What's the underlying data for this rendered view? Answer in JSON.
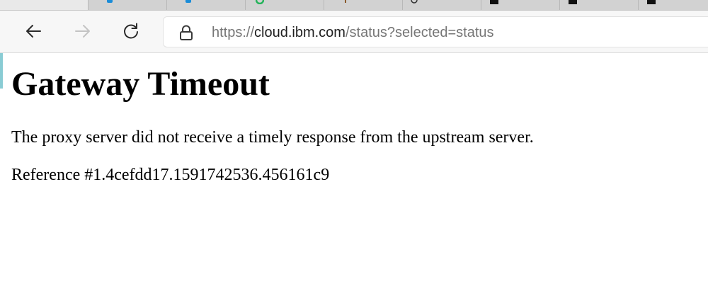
{
  "browser": {
    "tabs": [
      {
        "icon": "blue-favicon-icon",
        "accent": "#1a8cd8",
        "active": true
      },
      {
        "icon": "blue-favicon-icon",
        "accent": "#1a8cd8",
        "active": false
      },
      {
        "icon": "green-favicon-icon",
        "accent": "#24b35a",
        "active": false
      },
      {
        "icon": "brown-favicon-icon",
        "accent": "#8a5a2b",
        "active": false
      },
      {
        "icon": "github-favicon-icon",
        "accent": "#333333",
        "active": false
      },
      {
        "icon": "dark-favicon-icon",
        "accent": "#111111",
        "active": false
      },
      {
        "icon": "dark-favicon-icon",
        "accent": "#111111",
        "active": false
      },
      {
        "icon": "dark-favicon-icon",
        "accent": "#111111",
        "active": false
      },
      {
        "icon": "dark-favicon-icon",
        "accent": "#111111",
        "active": false
      }
    ],
    "toolbar": {
      "back_icon": "arrow-left-icon",
      "forward_icon": "arrow-right-icon",
      "reload_icon": "reload-icon",
      "lock_icon": "lock-icon"
    },
    "address": {
      "scheme": "https://",
      "host": "cloud.ibm.com",
      "path": "/status?selected=status"
    }
  },
  "page": {
    "title": "Gateway Timeout",
    "message": "The proxy server did not receive a timely response from the upstream server.",
    "reference": "Reference #1.4cefdd17.1591742536.456161c9"
  },
  "colors": {
    "toolbar_bg": "#f7f7f7",
    "tabstrip_bg": "#d2d2d2",
    "url_muted": "#767676",
    "url_host": "#1f1f1f"
  }
}
